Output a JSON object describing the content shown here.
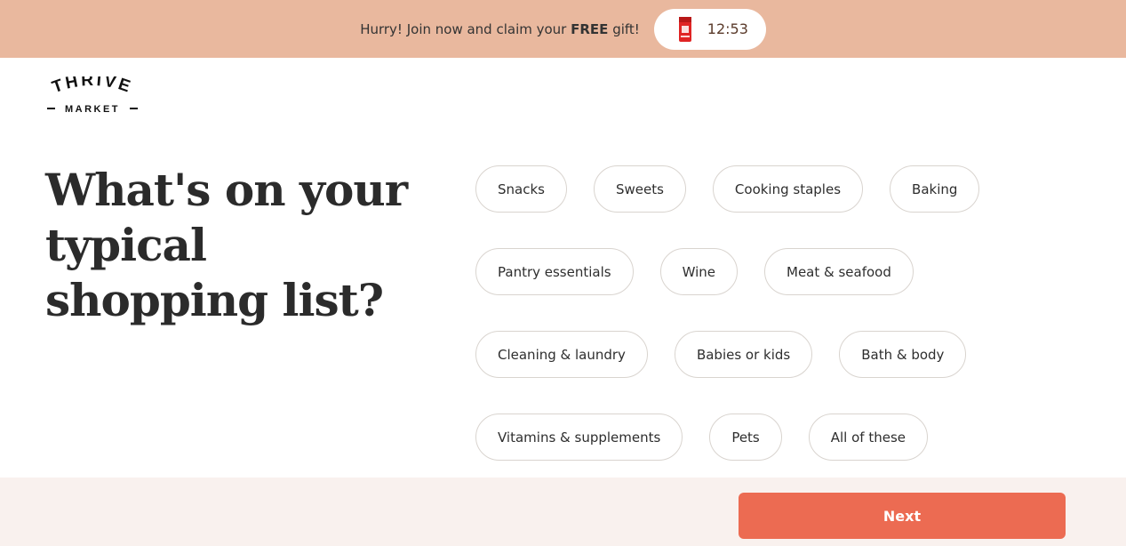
{
  "promo": {
    "text_prefix": "Hurry! Join now and claim your ",
    "text_bold": "FREE",
    "text_suffix": " gift!",
    "timer": "12:53",
    "gift_icon": "gift-box-icon"
  },
  "logo": {
    "line1": "THRIVE",
    "line2": "MARKET"
  },
  "question": "What's on your typical shopping list?",
  "options": [
    [
      "Snacks",
      "Sweets",
      "Cooking staples",
      "Baking"
    ],
    [
      "Pantry essentials",
      "Wine",
      "Meat & seafood"
    ],
    [
      "Cleaning & laundry",
      "Babies or kids",
      "Bath & body"
    ],
    [
      "Vitamins & supplements",
      "Pets",
      "All of these"
    ]
  ],
  "footer": {
    "next_label": "Next"
  },
  "colors": {
    "promo_bg": "#e9b89e",
    "accent": "#ec6b52",
    "footer_bg": "#f9f1ee"
  }
}
